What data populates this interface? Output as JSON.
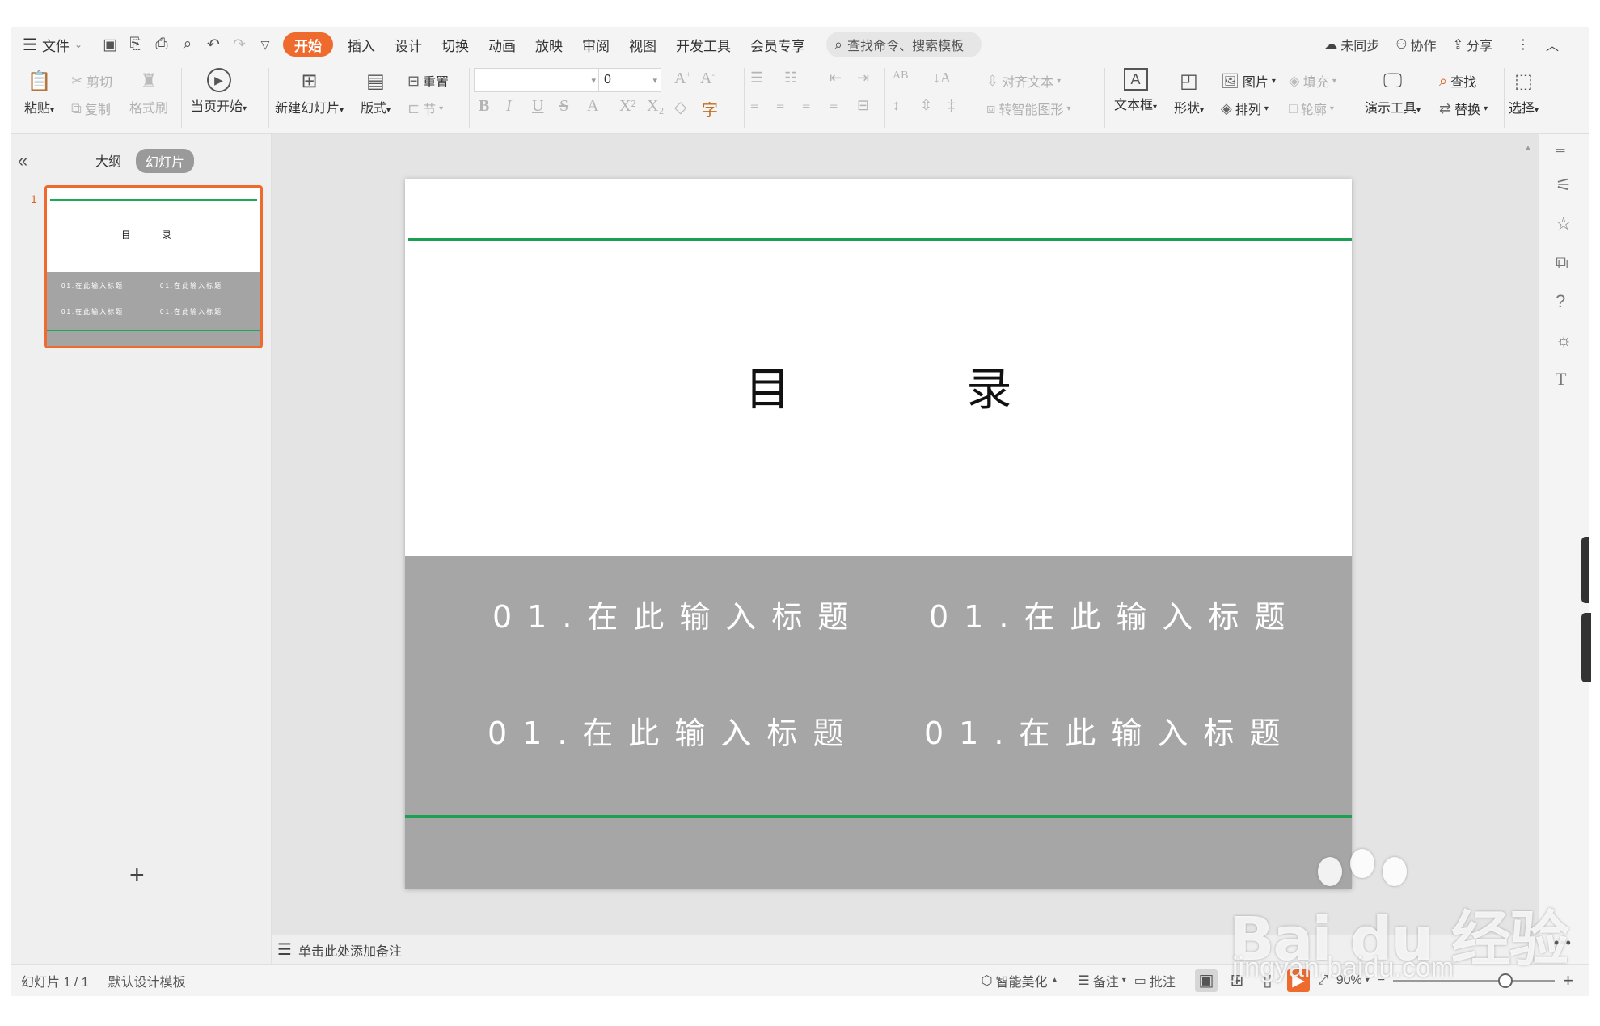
{
  "menu": {
    "file": "文件",
    "tabs": [
      "开始",
      "插入",
      "设计",
      "切换",
      "动画",
      "放映",
      "审阅",
      "视图",
      "开发工具",
      "会员专享"
    ],
    "active_tab": "开始",
    "search_placeholder": "查找命令、搜索模板",
    "sync": "未同步",
    "collab": "协作",
    "share": "分享"
  },
  "ribbon": {
    "paste": "粘贴",
    "cut": "剪切",
    "copy": "复制",
    "format_painter": "格式刷",
    "play_from_current": "当页开始",
    "new_slide": "新建幻灯片",
    "layout": "版式",
    "reset": "重置",
    "section": "节",
    "font_size": "0",
    "align_text": "对齐文本",
    "smartart": "转智能图形",
    "textbox": "文本框",
    "shape": "形状",
    "picture": "图片",
    "fill": "填充",
    "arrange": "排列",
    "outline": "轮廓",
    "presenter_tools": "演示工具",
    "find": "查找",
    "replace": "替换",
    "select": "选择"
  },
  "left_panel": {
    "outline_tab": "大纲",
    "slides_tab": "幻灯片",
    "slide_number": "1"
  },
  "slide": {
    "title": "目 录",
    "items": [
      "01.在此输入标题",
      "01.在此输入标题",
      "01.在此输入标题",
      "01.在此输入标题"
    ],
    "accent_color": "#1aa050",
    "band_color": "#a6a6a6"
  },
  "notes_placeholder": "单击此处添加备注",
  "status": {
    "slide_counter": "幻灯片 1 / 1",
    "template": "默认设计模板",
    "beautify": "智能美化",
    "notes": "备注",
    "comments": "批注",
    "zoom": "90%"
  },
  "watermark": {
    "brand": "Bai du 经验",
    "site": "jingyan.baidu.com"
  }
}
